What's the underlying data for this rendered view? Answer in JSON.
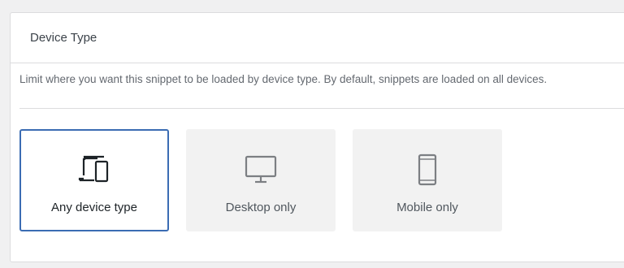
{
  "panel": {
    "title": "Device Type",
    "description": "Limit where you want this snippet to be loaded by device type. By default, snippets are loaded on all devices."
  },
  "options": [
    {
      "label": "Any device type",
      "icon": "devices-icon",
      "selected": true
    },
    {
      "label": "Desktop only",
      "icon": "desktop-icon",
      "selected": false
    },
    {
      "label": "Mobile only",
      "icon": "mobile-icon",
      "selected": false
    }
  ],
  "colors": {
    "selected_border": "#3b6cb3",
    "selected_icon": "#1d2327",
    "unselected_icon": "#7c7f83",
    "unselected_bg": "#f2f2f2"
  }
}
